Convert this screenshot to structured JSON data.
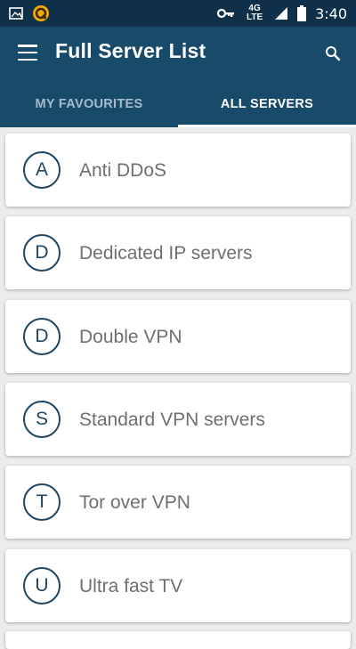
{
  "status_bar": {
    "network": "4G LTE",
    "time": "3:40",
    "icons": [
      "image-icon",
      "app-notification-icon",
      "vpn-key-icon",
      "signal-icon",
      "battery-icon"
    ]
  },
  "toolbar": {
    "title": "Full Server List",
    "menu_icon": "hamburger-menu-icon",
    "search_icon": "search-icon"
  },
  "tabs": [
    {
      "label": "MY FAVOURITES",
      "active": false
    },
    {
      "label": "ALL SERVERS",
      "active": true
    }
  ],
  "servers": [
    {
      "letter": "A",
      "label": "Anti DDoS"
    },
    {
      "letter": "D",
      "label": "Dedicated IP servers"
    },
    {
      "letter": "D",
      "label": "Double VPN"
    },
    {
      "letter": "S",
      "label": "Standard VPN servers"
    },
    {
      "letter": "T",
      "label": "Tor over VPN"
    },
    {
      "letter": "U",
      "label": "Ultra fast TV"
    }
  ],
  "colors": {
    "status_bar": "#0f3048",
    "app_bar": "#184a6a",
    "background": "#ececec",
    "accent": "#1f4763"
  }
}
